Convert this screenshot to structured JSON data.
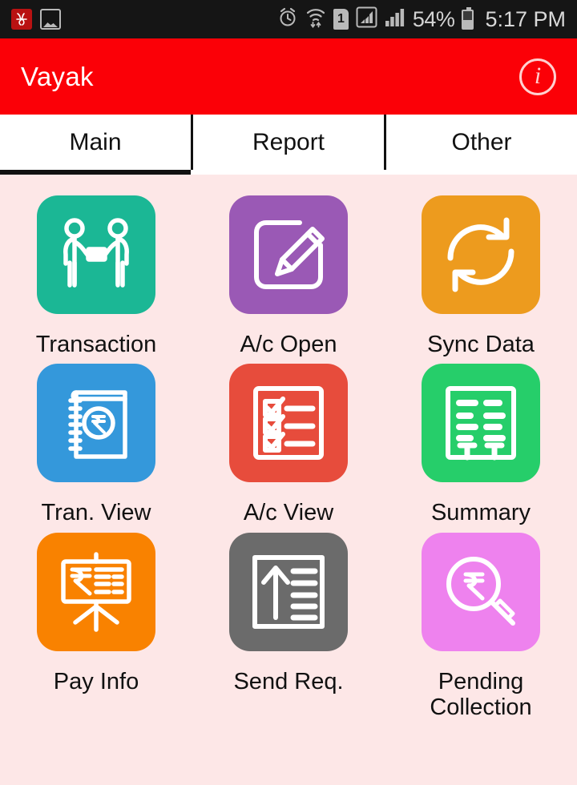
{
  "status_bar": {
    "left_icons": [
      {
        "name": "app-notification-icon",
        "glyph": "⚘"
      },
      {
        "name": "gallery-icon",
        "glyph": ""
      }
    ],
    "right_icons": [
      {
        "name": "alarm-clock-icon"
      },
      {
        "name": "wifi-icon"
      },
      {
        "name": "sim-one-icon",
        "label": "1"
      },
      {
        "name": "signal-boxed-icon"
      },
      {
        "name": "signal-bars-icon"
      }
    ],
    "battery_percent": "54%",
    "time": "5:17 PM"
  },
  "app_bar": {
    "title": "Vayak",
    "info_glyph": "i",
    "background_color": "#FB0007",
    "title_color": "#FFFFFF"
  },
  "tabs": {
    "items": [
      {
        "label": "Main",
        "active": true
      },
      {
        "label": "Report",
        "active": false
      },
      {
        "label": "Other",
        "active": false
      }
    ]
  },
  "page": {
    "background_color": "#FDE7E7"
  },
  "grid": {
    "items": [
      {
        "label": "Transaction",
        "icon": "handshake-money-icon",
        "color": "#1BB795"
      },
      {
        "label": "A/c Open",
        "icon": "edit-square-icon",
        "color": "#9A59B5"
      },
      {
        "label": "Sync Data",
        "icon": "sync-refresh-icon",
        "color": "#ED9B1E"
      },
      {
        "label": "Tran. View",
        "icon": "notebook-rupee-icon",
        "color": "#3498DB"
      },
      {
        "label": "A/c View",
        "icon": "checklist-icon",
        "color": "#E74C3C"
      },
      {
        "label": "Summary",
        "icon": "ledger-table-icon",
        "color": "#26CE6A"
      },
      {
        "label": "Pay Info",
        "icon": "presentation-rupee-icon",
        "color": "#F98200"
      },
      {
        "label": "Send Req.",
        "icon": "upload-document-icon",
        "color": "#6B6B6B"
      },
      {
        "label": "Pending Collection",
        "icon": "search-rupee-icon",
        "color": "#EE82EE"
      }
    ]
  }
}
